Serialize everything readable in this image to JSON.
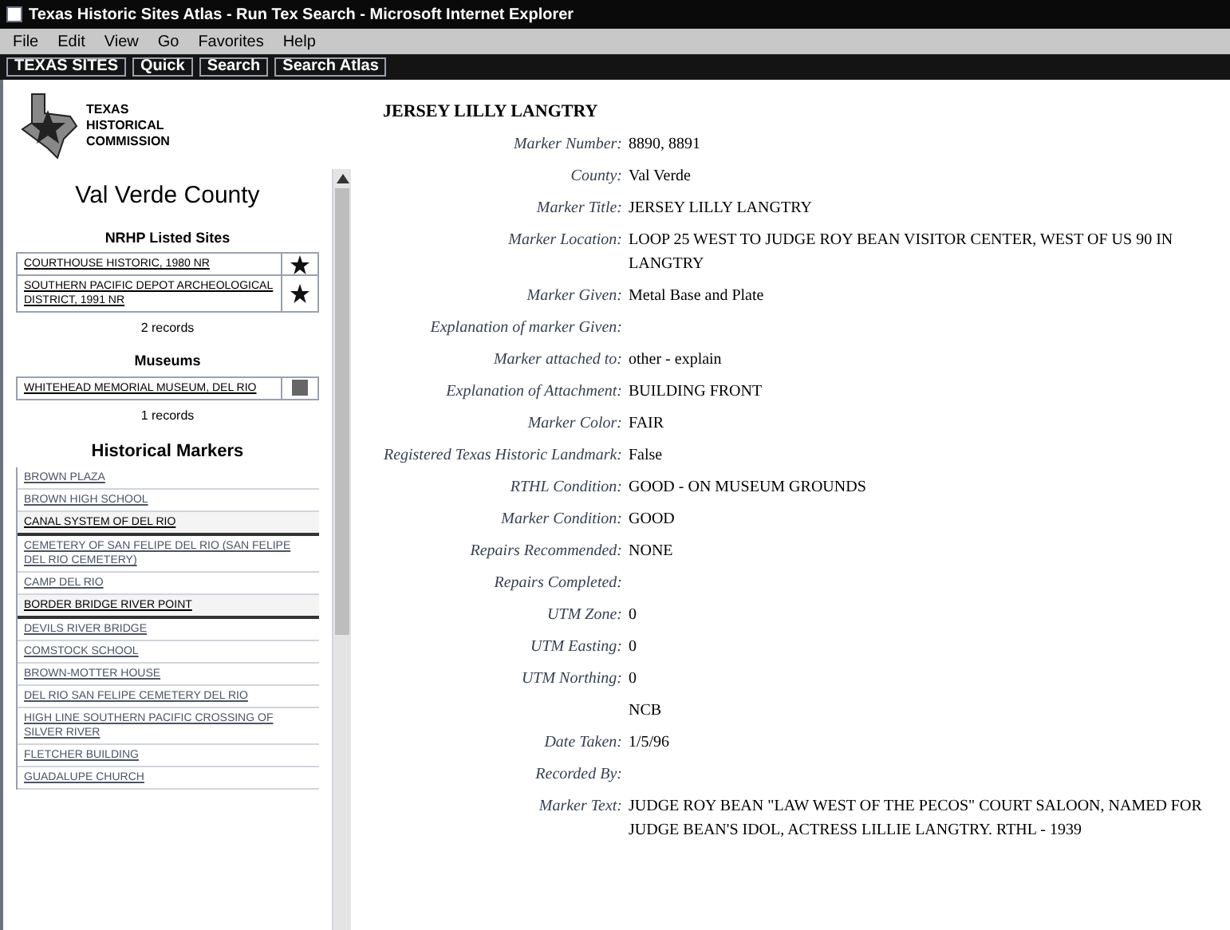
{
  "window": {
    "title": "Texas Historic Sites Atlas - Run Tex Search - Microsoft Internet Explorer"
  },
  "menu": [
    "File",
    "Edit",
    "View",
    "Go",
    "Favorites",
    "Help"
  ],
  "toolbar": [
    "TEXAS SITES",
    "Quick",
    "Search",
    "Search Atlas"
  ],
  "sidebar": {
    "logo_text": "TEXAS HISTORICAL COMMISSION",
    "county": "Val Verde County",
    "sections": [
      {
        "heading": "NRHP Listed Sites",
        "items": [
          {
            "text": "COURTHOUSE HISTORIC, 1980 NR"
          },
          {
            "text": "SOUTHERN PACIFIC DEPOT ARCHEOLOGICAL DISTRICT, 1991 NR"
          }
        ],
        "count": "2 records"
      },
      {
        "heading": "Museums",
        "items": [
          {
            "text": "WHITEHEAD MEMORIAL MUSEUM, DEL RIO"
          }
        ],
        "count": "1 records"
      }
    ],
    "markers_heading": "Historical Markers",
    "markers": [
      {
        "text": "BROWN PLAZA",
        "selected": false
      },
      {
        "text": "BROWN HIGH SCHOOL",
        "selected": false
      },
      {
        "text": "CANAL SYSTEM OF DEL RIO",
        "selected": true
      },
      {
        "text": "CEMETERY OF SAN FELIPE DEL RIO (SAN FELIPE DEL RIO CEMETERY)",
        "selected": false
      },
      {
        "text": "CAMP DEL RIO",
        "selected": false
      },
      {
        "text": "BORDER BRIDGE RIVER POINT",
        "selected": true
      },
      {
        "text": "DEVILS RIVER BRIDGE",
        "selected": false
      },
      {
        "text": "COMSTOCK SCHOOL",
        "selected": false
      },
      {
        "text": "BROWN-MOTTER HOUSE",
        "selected": false
      },
      {
        "text": "DEL RIO SAN FELIPE CEMETERY DEL RIO",
        "selected": false
      },
      {
        "text": "HIGH LINE SOUTHERN PACIFIC CROSSING OF SILVER RIVER",
        "selected": false
      },
      {
        "text": "FLETCHER BUILDING",
        "selected": false
      },
      {
        "text": "GUADALUPE CHURCH",
        "selected": false
      }
    ]
  },
  "detail": {
    "title": "JERSEY LILLY LANGTRY",
    "fields": [
      {
        "label": "Marker Number:",
        "value": "8890, 8891"
      },
      {
        "label": "County:",
        "value": "Val Verde"
      },
      {
        "label": "Marker Title:",
        "value": "JERSEY LILLY LANGTRY"
      },
      {
        "label": "Marker Location:",
        "value": "LOOP 25 WEST TO JUDGE ROY BEAN VISITOR CENTER, WEST OF US 90 IN LANGTRY"
      },
      {
        "label": "Marker Given:",
        "value": "Metal Base and Plate"
      },
      {
        "label": "Explanation of marker Given:"
      },
      {
        "label": "Marker attached to:",
        "value": "other - explain"
      },
      {
        "label": "Explanation of Attachment:",
        "value": "BUILDING FRONT"
      },
      {
        "label": "Marker Color:",
        "value": "FAIR"
      },
      {
        "label": "Registered Texas Historic Landmark:",
        "value": "False"
      },
      {
        "label": "RTHL Condition:",
        "value": "GOOD - ON MUSEUM GROUNDS"
      },
      {
        "label": "Marker Condition:",
        "value": "GOOD"
      },
      {
        "label": "Repairs Recommended:",
        "value": "NONE"
      },
      {
        "label": "Repairs Completed:"
      },
      {
        "label": "UTM Zone:",
        "value": "0"
      },
      {
        "label": "UTM Easting:",
        "value": "0"
      },
      {
        "label": "UTM Northing:",
        "value": "0"
      },
      {
        "value": "NCB"
      },
      {
        "label": "Date Taken:",
        "value": "1/5/96"
      },
      {
        "label": "Recorded By:"
      },
      {
        "label": "Marker Text:",
        "value": "JUDGE ROY BEAN \"LAW WEST OF THE PECOS\" COURT SALOON, NAMED FOR JUDGE BEAN'S IDOL, ACTRESS LILLIE LANGTRY. RTHL - 1939"
      }
    ]
  }
}
